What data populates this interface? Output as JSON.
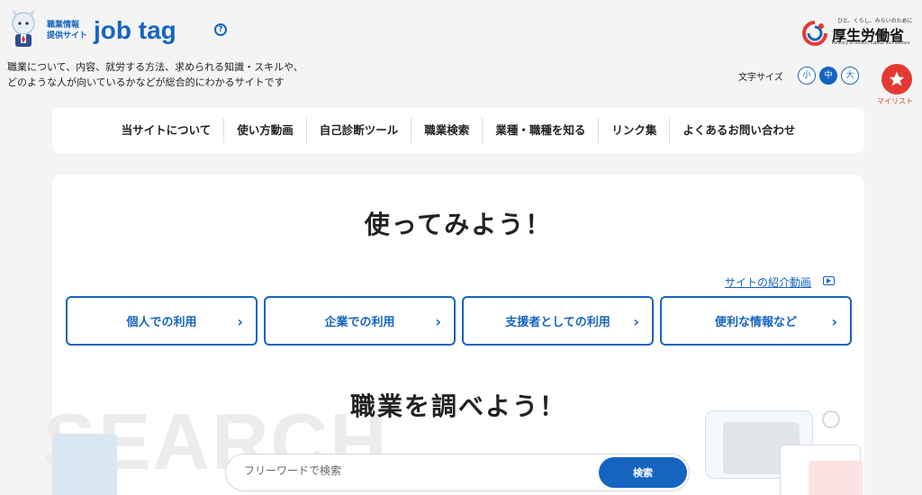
{
  "header": {
    "logo_small": "職業情報\n提供サイト",
    "logo_main": "job tag",
    "help_symbol": "?",
    "tagline_line1": "職業について、内容、就労する方法、求められる知識・スキルや、",
    "tagline_line2": "どのような人が向いているかなどが総合的にわかるサイトです",
    "ministry_sub": "ひと、くらし、みらいのために",
    "ministry_name": "厚生労働省",
    "ministry_en": "Ministry of Health, Labour and Welfare",
    "font_size_label": "文字サイズ",
    "font_sizes": [
      "小",
      "中",
      "大"
    ],
    "font_size_selected": "中",
    "mylist_label": "マイリスト"
  },
  "nav": {
    "items": [
      "当サイトについて",
      "使い方動画",
      "自己診断ツール",
      "職業検索",
      "業種・職種を知る",
      "リンク集",
      "よくあるお問い合わせ"
    ]
  },
  "main": {
    "try_heading": "使ってみよう！",
    "video_link": "サイトの紹介動画",
    "usage_buttons": [
      "個人での利用",
      "企業での利用",
      "支援者としての利用",
      "便利な情報など"
    ],
    "search_heading": "職業を調べよう！",
    "search_bg_text": "SEARCH",
    "search_placeholder": "フリーワードで検索",
    "search_button": "検索"
  },
  "colors": {
    "brand": "#1565c0",
    "accent_red": "#e53935",
    "background": "#f4f4f4"
  },
  "icons": [
    "mascot-icon",
    "help-icon",
    "ministry-logo-icon",
    "star-icon",
    "video-icon",
    "chevron-right-icon"
  ]
}
